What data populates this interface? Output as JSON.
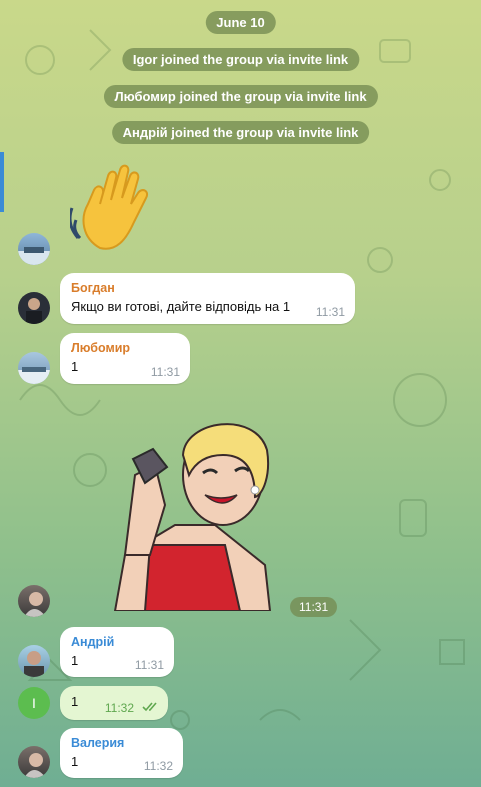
{
  "date_label": "June 10",
  "service_messages": [
    "Igor joined the group via invite link",
    "Любомир joined the group via invite link",
    "Андрій joined the group via invite link"
  ],
  "messages": [
    {
      "sender": "Богдан",
      "text": "Якщо ви готові, дайте відповідь на 1",
      "time": "11:31",
      "color": "#d97d2b"
    },
    {
      "sender": "Любомир",
      "text": "1",
      "time": "11:31",
      "color": "#d97d2b"
    },
    {
      "sender": "Андрій",
      "text": "1",
      "time": "11:31",
      "color": "#3a8bd6"
    },
    {
      "text": "1",
      "time": "11:32"
    },
    {
      "sender": "Валерия",
      "text": "1",
      "time": "11:32",
      "color": "#3a8bd6"
    }
  ],
  "sticker_time": "11:31",
  "my_avatar_letter": "I",
  "colors": {
    "accent": "#3a8bd6",
    "service_pill": "#748c52",
    "outgoing": "#e4f6d2"
  }
}
